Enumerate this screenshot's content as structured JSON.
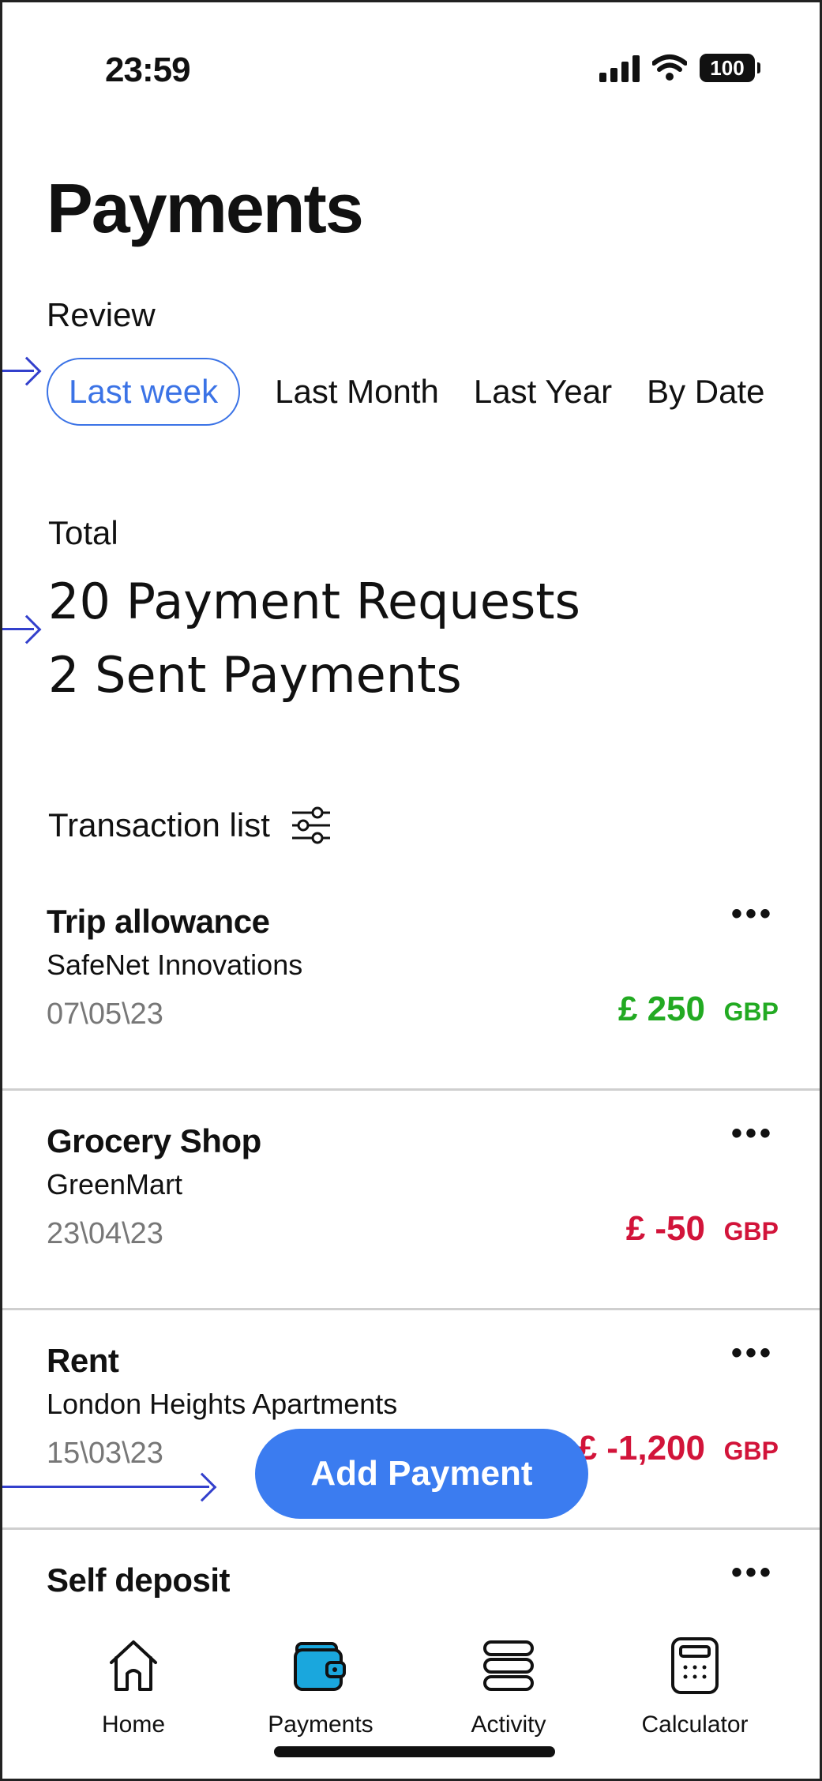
{
  "status_bar": {
    "time": "23:59",
    "battery": "100",
    "icons": [
      "cellular-signal-icon",
      "wifi-icon",
      "battery-icon"
    ]
  },
  "header": {
    "title": "Payments"
  },
  "review": {
    "label": "Review",
    "filters": [
      {
        "label": "Last week",
        "selected": true
      },
      {
        "label": "Last Month",
        "selected": false
      },
      {
        "label": "Last Year",
        "selected": false
      },
      {
        "label": "By Date",
        "selected": false
      }
    ]
  },
  "totals": {
    "label": "Total",
    "payment_requests": "20 Payment Requests",
    "sent_payments": "2 Sent Payments"
  },
  "transactions": {
    "label": "Transaction list",
    "filter_icon": "sliders-icon",
    "items": [
      {
        "title": "Trip allowance",
        "merchant": "SafeNet Innovations",
        "date": "07\\05\\23",
        "amount": "£ 250",
        "currency": "GBP",
        "sign": "positive"
      },
      {
        "title": "Grocery Shop",
        "merchant": "GreenMart",
        "date": "23\\04\\23",
        "amount": "£ -50",
        "currency": "GBP",
        "sign": "negative"
      },
      {
        "title": "Rent",
        "merchant": "London Heights Apartments",
        "date": "15\\03\\23",
        "amount": "£ -1,200",
        "currency": "GBP",
        "sign": "negative"
      },
      {
        "title": "Self deposit"
      }
    ],
    "more_label": "•••"
  },
  "fab": {
    "label": "Add Payment"
  },
  "tabbar": {
    "items": [
      {
        "label": "Home",
        "icon": "home-icon"
      },
      {
        "label": "Payments",
        "icon": "wallet-icon",
        "active": true
      },
      {
        "label": "Activity",
        "icon": "stack-icon"
      },
      {
        "label": "Calculator",
        "icon": "calculator-icon"
      }
    ]
  },
  "colors": {
    "accent": "#3b7cf0",
    "filter_selected": "#3b73e6",
    "positive": "#22aa22",
    "negative": "#d2143a",
    "annotation_arrow": "#3340cc",
    "wallet_fill": "#1aa7dd"
  }
}
